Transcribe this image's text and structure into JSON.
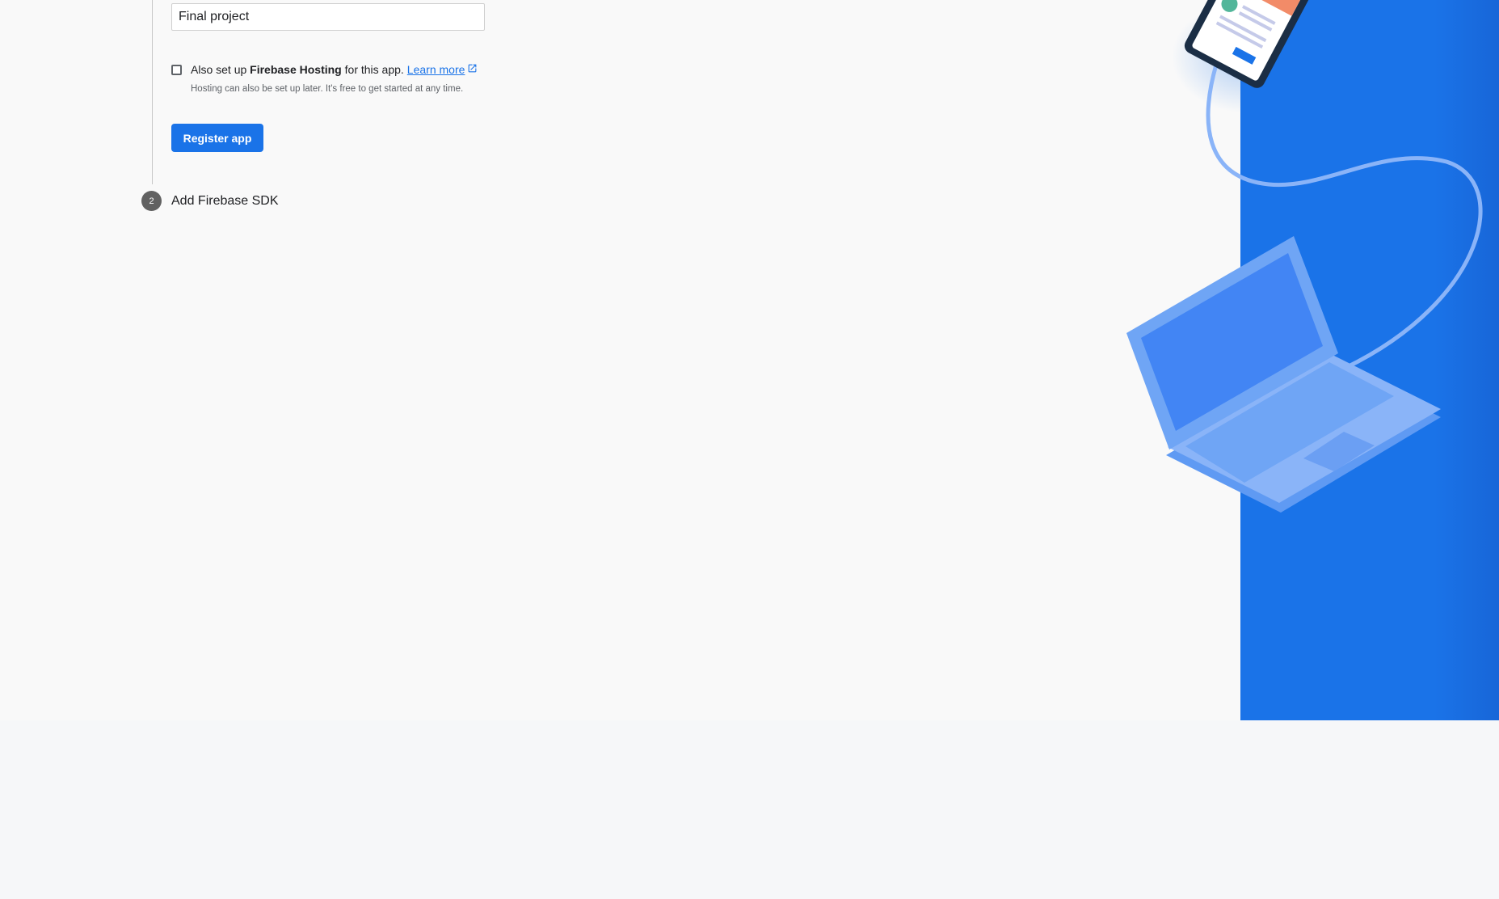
{
  "app_form": {
    "nickname_value": "Final project",
    "hosting_checkbox_checked": false,
    "hosting_prefix": "Also set up",
    "hosting_bold": "Firebase Hosting",
    "hosting_suffix": "for this app.",
    "learn_more_label": "Learn more",
    "helper_text": "Hosting can also be set up later. It's free to get started at any time.",
    "register_button_label": "Register app"
  },
  "steps": [
    {
      "number": "2",
      "title": "Add Firebase SDK"
    }
  ],
  "colors": {
    "accent": "#1a73e8",
    "illustration_panel": "#1a73e8",
    "page_background": "#f9f9f9",
    "footer_background": "#f6f7f9"
  },
  "icons": [
    "external-link-icon",
    "laptop-illustration",
    "phone-illustration"
  ]
}
